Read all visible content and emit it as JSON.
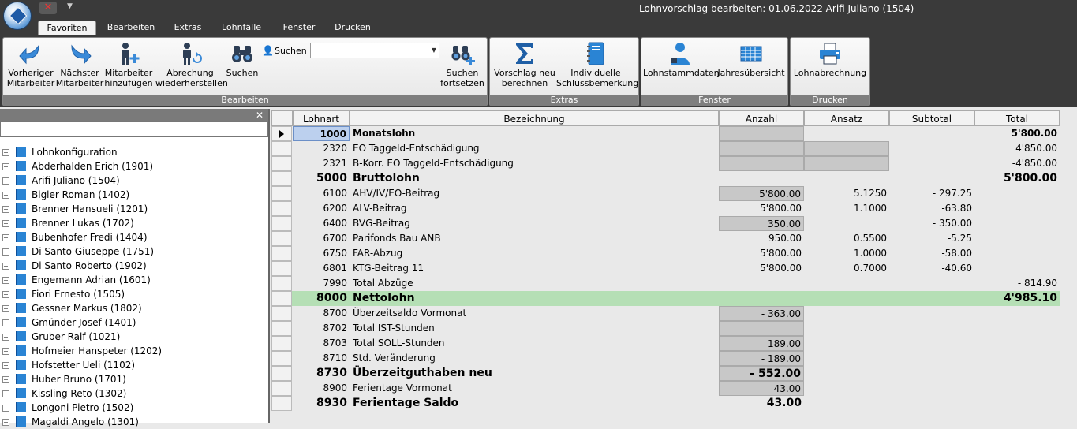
{
  "window": {
    "title": "Lohnvorschlag bearbeiten: 01.06.2022 Arifi Juliano (1504)"
  },
  "qat": {
    "close_glyph": "✕",
    "dropdown_glyph": "▼"
  },
  "tabs": [
    {
      "label": "Favoriten",
      "active": true
    },
    {
      "label": "Bearbeiten"
    },
    {
      "label": "Extras"
    },
    {
      "label": "Lohnfälle"
    },
    {
      "label": "Fenster"
    },
    {
      "label": "Drucken"
    }
  ],
  "ribbon": {
    "bearbeiten": {
      "label": "Bearbeiten",
      "buttons": [
        {
          "label": "Vorheriger\nMitarbeiter",
          "icon": "arrow-left-icon"
        },
        {
          "label": "Nächster\nMitarbeiter",
          "icon": "arrow-right-icon"
        },
        {
          "label": "Mitarbeiter\nhinzufügen",
          "icon": "add-person-icon"
        },
        {
          "label": "Abrechung\nwiederherstellen",
          "icon": "restore-person-icon"
        },
        {
          "label": "Suchen",
          "icon": "binoculars-icon"
        },
        {
          "label": "Suchen\nfortsetzen",
          "icon": "binoculars-plus-icon"
        }
      ],
      "search_label": "Suchen",
      "search_value": ""
    },
    "extras": {
      "label": "Extras",
      "buttons": [
        {
          "label": "Vorschlag neu\nberechnen",
          "icon": "sigma-icon"
        },
        {
          "label": "Individuelle\nSchlussbemerkung",
          "icon": "notebook-icon"
        }
      ]
    },
    "fenster": {
      "label": "Fenster",
      "buttons": [
        {
          "label": "Lohnstammdaten",
          "icon": "person-icon"
        },
        {
          "label": "Jahresübersicht",
          "icon": "table-icon"
        }
      ]
    },
    "drucken": {
      "label": "Drucken",
      "buttons": [
        {
          "label": "Lohnabrechnung",
          "icon": "printer-icon"
        }
      ]
    }
  },
  "panel": {
    "close_glyph": "✕",
    "search_value": ""
  },
  "tree": [
    "Lohnkonfiguration",
    "Abderhalden Erich (1901)",
    "Arifi Juliano (1504)",
    "Bigler Roman (1402)",
    "Brenner Hansueli (1201)",
    "Brenner Lukas (1702)",
    "Bubenhofer Fredi (1404)",
    "Di Santo Giuseppe (1751)",
    "Di Santo Roberto (1902)",
    "Engemann Adrian (1601)",
    "Fiori Ernesto (1505)",
    "Gessner Markus (1802)",
    "Gmünder Josef (1401)",
    "Gruber Ralf (1021)",
    "Hofmeier Hanspeter (1202)",
    "Hofstetter Ueli (1102)",
    "Huber Bruno (1701)",
    "Kissling Reto (1302)",
    "Longoni Pietro (1502)",
    "Magaldi Angelo (1301)"
  ],
  "grid": {
    "columns": [
      "Lohnart",
      "Bezeichnung",
      "Anzahl",
      "Ansatz",
      "Subtotal",
      "Total"
    ],
    "rows": [
      {
        "lohnart": "1000",
        "bez": "Monatslohn",
        "anzahl": "",
        "ansatz": "",
        "subtotal": "",
        "total": "5'800.00",
        "style": "bold",
        "anzahl_box": true,
        "selected": true
      },
      {
        "lohnart": "2320",
        "bez": "EO Taggeld-Entschädigung",
        "anzahl": "",
        "ansatz": "",
        "subtotal": "",
        "total": "4'850.00",
        "anzahl_box": true,
        "ansatz_box": true
      },
      {
        "lohnart": "2321",
        "bez": "B-Korr. EO Taggeld-Entschädigung",
        "anzahl": "",
        "ansatz": "",
        "subtotal": "",
        "total": "-4'850.00",
        "anzahl_box": true,
        "ansatz_box": true
      },
      {
        "lohnart": "5000",
        "bez": "Bruttolohn",
        "anzahl": "",
        "ansatz": "",
        "subtotal": "",
        "total": "5'800.00",
        "style": "big"
      },
      {
        "lohnart": "6100",
        "bez": "AHV/IV/EO-Beitrag",
        "anzahl": "5'800.00",
        "ansatz": "5.1250",
        "subtotal": "- 297.25",
        "total": "",
        "anzahl_box": true
      },
      {
        "lohnart": "6200",
        "bez": "ALV-Beitrag",
        "anzahl": "5'800.00",
        "ansatz": "1.1000",
        "subtotal": "-63.80",
        "total": ""
      },
      {
        "lohnart": "6400",
        "bez": "BVG-Beitrag",
        "anzahl": "350.00",
        "ansatz": "",
        "subtotal": "- 350.00",
        "total": "",
        "anzahl_box": true
      },
      {
        "lohnart": "6700",
        "bez": "Parifonds Bau ANB",
        "anzahl": "950.00",
        "ansatz": "0.5500",
        "subtotal": "-5.25",
        "total": ""
      },
      {
        "lohnart": "6750",
        "bez": "FAR-Abzug",
        "anzahl": "5'800.00",
        "ansatz": "1.0000",
        "subtotal": "-58.00",
        "total": ""
      },
      {
        "lohnart": "6801",
        "bez": "KTG-Beitrag 11",
        "anzahl": "5'800.00",
        "ansatz": "0.7000",
        "subtotal": "-40.60",
        "total": ""
      },
      {
        "lohnart": "7990",
        "bez": "Total Abzüge",
        "anzahl": "",
        "ansatz": "",
        "subtotal": "",
        "total": "- 814.90"
      },
      {
        "lohnart": "8000",
        "bez": "Nettolohn",
        "anzahl": "",
        "ansatz": "",
        "subtotal": "",
        "total": "4'985.10",
        "style": "big",
        "highlight": true
      },
      {
        "lohnart": "8700",
        "bez": "Überzeitsaldo Vormonat",
        "anzahl": "- 363.00",
        "ansatz": "",
        "subtotal": "",
        "total": "",
        "anzahl_box": true
      },
      {
        "lohnart": "8702",
        "bez": "Total IST-Stunden",
        "anzahl": "",
        "ansatz": "",
        "subtotal": "",
        "total": "",
        "anzahl_box": true
      },
      {
        "lohnart": "8703",
        "bez": "Total SOLL-Stunden",
        "anzahl": "189.00",
        "ansatz": "",
        "subtotal": "",
        "total": "",
        "anzahl_box": true
      },
      {
        "lohnart": "8710",
        "bez": "Std. Veränderung",
        "anzahl": "- 189.00",
        "ansatz": "",
        "subtotal": "",
        "total": "",
        "anzahl_box": true
      },
      {
        "lohnart": "8730",
        "bez": "Überzeitguthaben neu",
        "anzahl": "- 552.00",
        "ansatz": "",
        "subtotal": "",
        "total": "",
        "style": "big",
        "anzahl_box": true
      },
      {
        "lohnart": "8900",
        "bez": "Ferientage Vormonat",
        "anzahl": "43.00",
        "ansatz": "",
        "subtotal": "",
        "total": "",
        "anzahl_box": true
      },
      {
        "lohnart": "8930",
        "bez": "Ferientage Saldo",
        "anzahl": "43.00",
        "ansatz": "",
        "subtotal": "",
        "total": "",
        "style": "big"
      }
    ]
  }
}
